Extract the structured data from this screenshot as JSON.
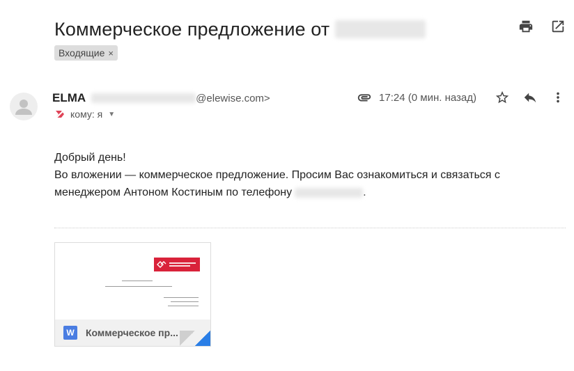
{
  "subject": {
    "text": "Коммерческое предложение от"
  },
  "labels": [
    {
      "name": "Входящие",
      "remove_symbol": "×"
    }
  ],
  "top_actions": {
    "print_icon": "print-icon",
    "open_new_window_icon": "open-in-new-window-icon"
  },
  "sender": {
    "name": "ELMA",
    "email_visible": "@elewise.com>"
  },
  "recipient": {
    "text": "кому: я"
  },
  "meta": {
    "time": "17:24 (0 мин. назад)",
    "attachment_icon": "paperclip-icon",
    "star_icon": "star-icon",
    "reply_icon": "reply-icon",
    "more_icon": "more-vert-icon"
  },
  "body": {
    "greeting": "Добрый день!",
    "line2": "Во вложении — коммерческое предложение. Просим Вас ознакомиться и связаться с",
    "line3_prefix": "менеджером Антоном Костиным по телефону",
    "line3_suffix": "."
  },
  "attachment": {
    "filename": "Коммерческое пр...",
    "type_letter": "W"
  },
  "colors": {
    "accent_blue": "#2a7ee6",
    "word_blue": "#4a7de2",
    "logo_red": "#d9223a",
    "chip_bg": "#dddddd"
  }
}
